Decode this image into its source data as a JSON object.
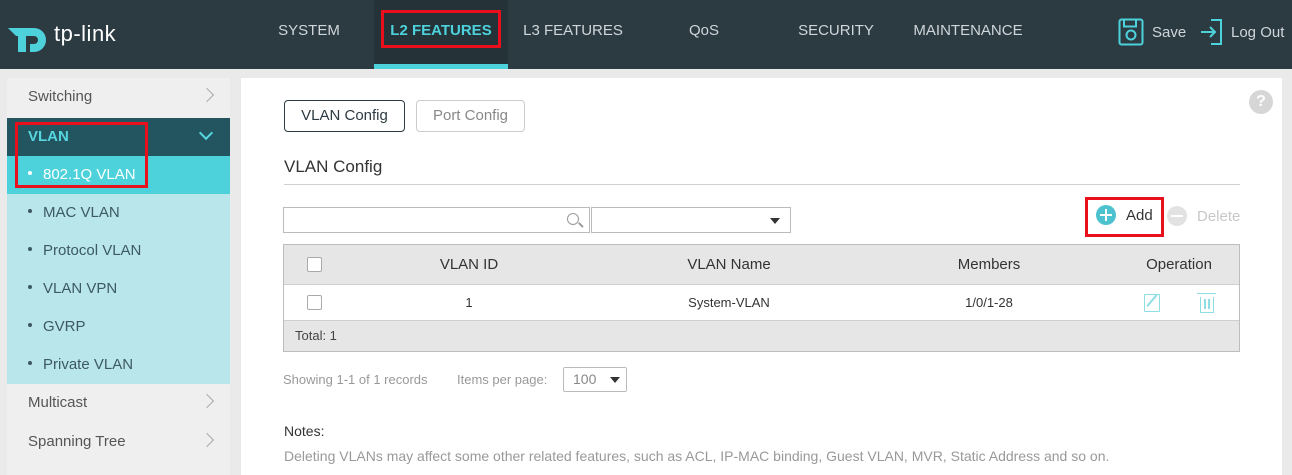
{
  "brand": {
    "name": "tp-link",
    "accent": "#4dd2dc",
    "highlight": "#e8101c"
  },
  "nav": {
    "items": [
      {
        "label": "SYSTEM"
      },
      {
        "label": "L2 FEATURES"
      },
      {
        "label": "L3 FEATURES"
      },
      {
        "label": "QoS"
      },
      {
        "label": "SECURITY"
      },
      {
        "label": "MAINTENANCE"
      }
    ],
    "active": "L2 FEATURES",
    "save_label": "Save",
    "logout_label": "Log Out"
  },
  "sidebar": {
    "items": [
      {
        "label": "Switching"
      },
      {
        "label": "VLAN"
      },
      {
        "label": "Multicast"
      },
      {
        "label": "Spanning Tree"
      }
    ],
    "vlan_subitems": [
      {
        "label": "802.1Q VLAN"
      },
      {
        "label": "MAC VLAN"
      },
      {
        "label": "Protocol VLAN"
      },
      {
        "label": "VLAN VPN"
      },
      {
        "label": "GVRP"
      },
      {
        "label": "Private VLAN"
      }
    ],
    "active_subitem": "802.1Q VLAN"
  },
  "main": {
    "help_glyph": "?",
    "tabs": [
      {
        "label": "VLAN Config"
      },
      {
        "label": "Port Config"
      }
    ],
    "active_tab": "VLAN Config",
    "section_title": "VLAN Config",
    "search": {
      "value": "",
      "placeholder": ""
    },
    "filter": {
      "value": ""
    },
    "add_label": "Add",
    "delete_label": "Delete",
    "table": {
      "columns": [
        "VLAN ID",
        "VLAN Name",
        "Members",
        "Operation"
      ],
      "rows": [
        {
          "vlan_id": "1",
          "vlan_name": "System-VLAN",
          "members": "1/0/1-28"
        }
      ],
      "total": "Total: 1"
    },
    "records_text": "Showing 1-1 of 1 records",
    "items_per_page_label": "Items per page:",
    "items_per_page_value": "100",
    "notes_title": "Notes:",
    "notes_text": "Deleting VLANs may affect some other related features, such as ACL, IP-MAC binding, Guest VLAN, MVR, Static Address and so on."
  }
}
